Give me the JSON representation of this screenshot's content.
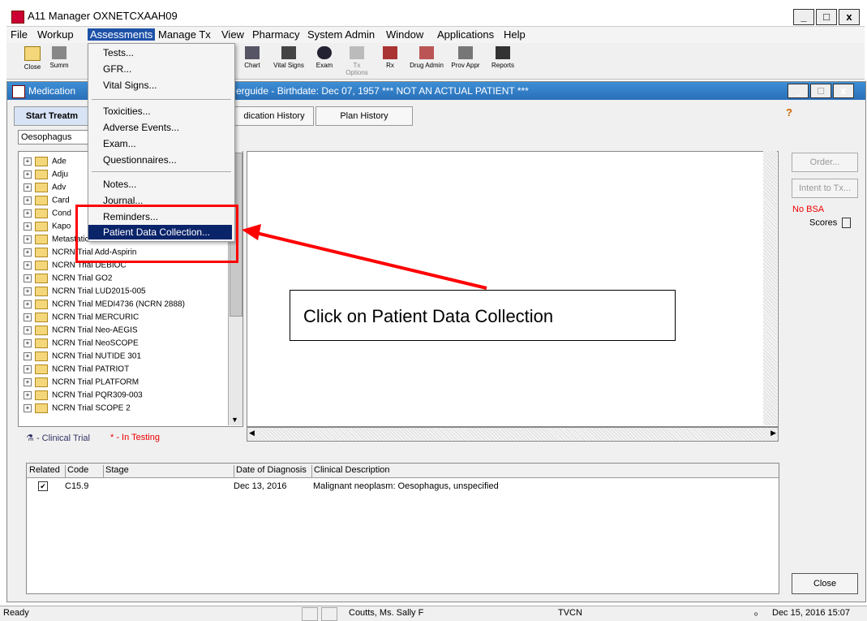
{
  "window": {
    "title": "A11 Manager OXNETCXAAH09",
    "min": "_",
    "max": "□",
    "close": "x"
  },
  "menu": [
    "File",
    "Workup",
    "Assessments",
    "Manage Tx",
    "View",
    "Pharmacy",
    "System Admin",
    "Window",
    "Applications",
    "Help"
  ],
  "toolbar": [
    {
      "label": "Close",
      "icon": "folder-icon"
    },
    {
      "label": "Summ",
      "icon": "summary-icon"
    },
    {
      "label": "Chart",
      "icon": "chart-icon"
    },
    {
      "label": "Vital Signs",
      "icon": "vital-signs-icon"
    },
    {
      "label": "Exam",
      "icon": "exam-icon"
    },
    {
      "label": "Tx Options",
      "icon": "tx-options-icon"
    },
    {
      "label": "Rx",
      "icon": "rx-icon"
    },
    {
      "label": "Drug Admin",
      "icon": "drug-admin-icon"
    },
    {
      "label": "Prov Appr",
      "icon": "prov-appr-icon"
    },
    {
      "label": "Reports",
      "icon": "reports-icon"
    }
  ],
  "inner_window": {
    "title_left": "Medication",
    "title_right": "erguide - Birthdate: Dec 07, 1957 *** NOT AN ACTUAL PATIENT ***"
  },
  "tabs": [
    "Start Treatm",
    "dication History",
    "Plan History"
  ],
  "combo_value": "Oesophagus",
  "tree": [
    "Ade",
    "Adju",
    "Adv",
    "Card",
    "Cond",
    "Kapo",
    "Metastatic",
    "NCRN Trial Add-Aspirin",
    "NCRN Trial DEBIOC",
    "NCRN Trial GO2",
    "NCRN Trial LUD2015-005",
    "NCRN Trial MEDI4736 (NCRN 2888)",
    "NCRN Trial MERCURIC",
    "NCRN Trial Neo-AEGIS",
    "NCRN Trial NeoSCOPE",
    "NCRN Trial NUTIDE 301",
    "NCRN Trial PATRIOT",
    "NCRN Trial PLATFORM",
    "NCRN Trial PQR309-003",
    "NCRN Trial SCOPE 2"
  ],
  "legend": {
    "clinical_trial": "- Clinical Trial",
    "in_testing": "* - In Testing"
  },
  "side": {
    "order": "Order...",
    "intent": "Intent to Tx...",
    "no_bsa": "No BSA",
    "scores": "Scores"
  },
  "grid": {
    "headers": [
      "Related",
      "Code",
      "Stage",
      "Date of Diagnosis",
      "Clinical Description"
    ],
    "rows": [
      {
        "code": "C15.9",
        "stage": "",
        "date": "Dec 13, 2016",
        "desc": "Malignant neoplasm: Oesophagus, unspecified",
        "checked": true
      }
    ]
  },
  "close_label": "Close",
  "dropdown": [
    "Tests...",
    "GFR...",
    "Vital Signs...",
    "Toxicities...",
    "Adverse Events...",
    "Exam...",
    "Questionnaires...",
    "Notes...",
    "Journal...",
    "Reminders...",
    "Patient Data Collection..."
  ],
  "callout": "Click on Patient Data Collection",
  "status": {
    "ready": "Ready",
    "user": "Coutts, Ms. Sally F",
    "site": "TVCN",
    "indicator": "ₒ",
    "datetime": "Dec 15, 2016 15:07"
  },
  "colors": {
    "highlight": "#0a246a",
    "annotation_red": "#ff0000",
    "menu_active": "#1e52a8"
  }
}
